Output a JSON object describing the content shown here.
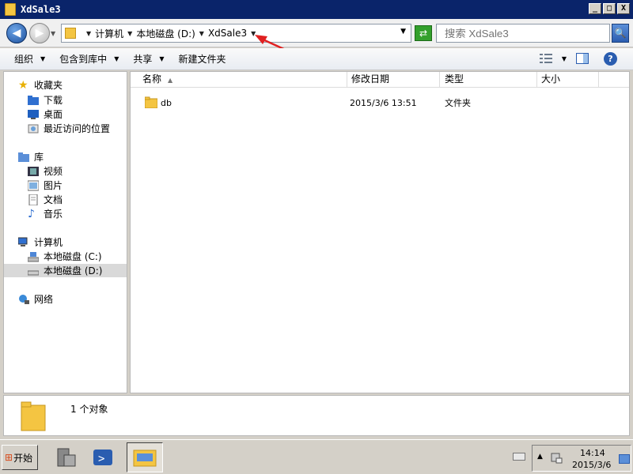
{
  "window": {
    "title": "XdSale3"
  },
  "window_controls": {
    "minimize": "_",
    "maximize": "□",
    "close": "X"
  },
  "address": {
    "crumbs": [
      "计算机",
      "本地磁盘 (D:)",
      "XdSale3"
    ]
  },
  "search": {
    "placeholder": "搜索 XdSale3"
  },
  "toolbar": {
    "organize": "组织",
    "include_in_library": "包含到库中",
    "share": "共享",
    "new_folder": "新建文件夹"
  },
  "nav": {
    "favorites": "收藏夹",
    "downloads": "下载",
    "desktop": "桌面",
    "recent": "最近访问的位置",
    "libraries": "库",
    "videos": "视频",
    "pictures": "图片",
    "documents": "文档",
    "music": "音乐",
    "computer": "计算机",
    "drive_c": "本地磁盘 (C:)",
    "drive_d": "本地磁盘 (D:)",
    "network": "网络"
  },
  "columns": {
    "name": "名称",
    "modified": "修改日期",
    "type": "类型",
    "size": "大小"
  },
  "files": [
    {
      "name": "db",
      "modified": "2015/3/6 13:51",
      "type": "文件夹",
      "size": ""
    }
  ],
  "details": {
    "count": "1 个对象"
  },
  "taskbar": {
    "start": "开始",
    "time": "14:14",
    "date": "2015/3/6"
  },
  "colors": {
    "titlebar": "#0a246a",
    "folder": "#f4c542",
    "annotation_arrow": "#e02020"
  }
}
